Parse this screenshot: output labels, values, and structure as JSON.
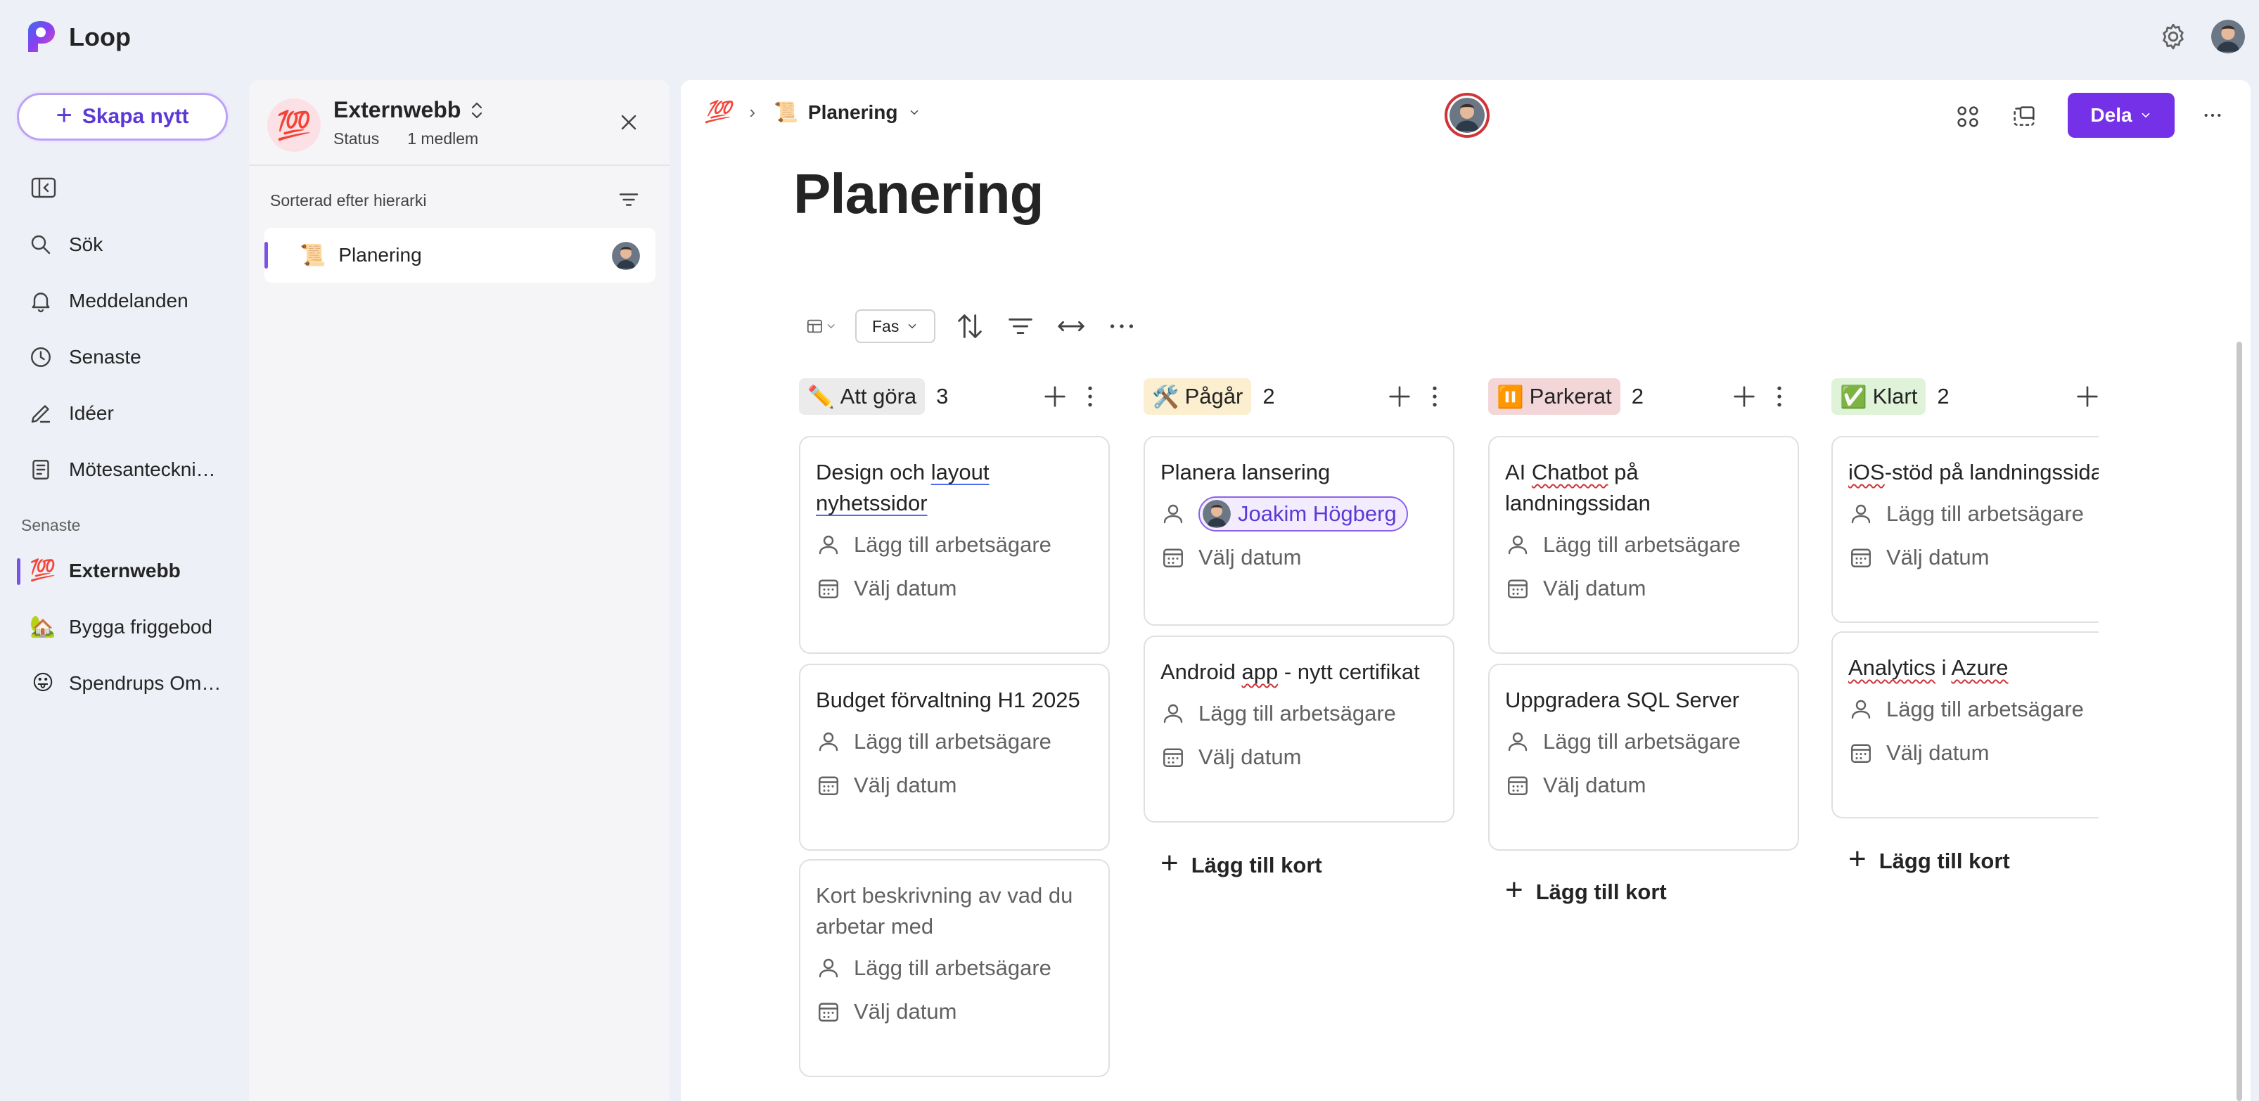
{
  "app": {
    "name": "Loop"
  },
  "nav": {
    "create_label": "Skapa nytt",
    "items": [
      {
        "label": "Sök",
        "icon": "search-icon"
      },
      {
        "label": "Meddelanden",
        "icon": "bell-icon"
      },
      {
        "label": "Senaste",
        "icon": "clock-icon"
      },
      {
        "label": "Idéer",
        "icon": "pencil-icon"
      },
      {
        "label": "Mötesanteckningar",
        "icon": "notes-icon"
      }
    ],
    "recent_label": "Senaste",
    "workspaces": [
      {
        "label": "Externwebb",
        "emoji": "💯",
        "active": true
      },
      {
        "label": "Bygga friggebod",
        "emoji": "🏡",
        "active": false
      },
      {
        "label": "Spendrups Omvärldsbevakning",
        "emoji": "😛",
        "active": false
      }
    ]
  },
  "workspace_panel": {
    "title": "Externwebb",
    "status": "Status",
    "members": "1 medlem",
    "sort_label": "Sorterad efter hierarki",
    "pages": [
      {
        "label": "Planering",
        "emoji": "📜"
      }
    ]
  },
  "main": {
    "breadcrumb": {
      "workspace_emoji": "💯",
      "page": "Planering",
      "page_emoji": "📜"
    },
    "share_label": "Dela",
    "title": "Planering",
    "toolbar": {
      "group_by": "Fas"
    },
    "columns": [
      {
        "label": "Att göra",
        "emoji": "✏️",
        "count": "3",
        "pill_color": "#ebebeb",
        "cards": [
          {
            "title_a": "Design och ",
            "title_b": "layout nyhetssidor",
            "owner": "Lägg till arbetsägare",
            "date": "Välj datum"
          },
          {
            "title": "Budget förvaltning H1 2025",
            "owner": "Lägg till arbetsägare",
            "date": "Välj datum"
          },
          {
            "title": "Kort beskrivning av vad du arbetar med",
            "owner": "Lägg till arbetsägare",
            "date": "Välj datum"
          }
        ]
      },
      {
        "label": "Pågår",
        "emoji": "🛠️",
        "count": "2",
        "pill_color": "#fbefcf",
        "cards": [
          {
            "title": "Planera lansering",
            "owner_name": "Joakim Högberg",
            "date": "Välj datum"
          },
          {
            "title_a": "Android ",
            "title_b": "app",
            "title_c": " - nytt certifikat",
            "owner": "Lägg till arbetsägare",
            "date": "Välj datum"
          }
        ],
        "add_label": "Lägg till kort"
      },
      {
        "label": "Parkerat",
        "emoji": "⏸️",
        "count": "2",
        "pill_color": "#f3d6d8",
        "cards": [
          {
            "title_a": "AI ",
            "title_b": "Chatbot",
            "title_c": " på landningssidan",
            "owner": "Lägg till arbetsägare",
            "date": "Välj datum"
          },
          {
            "title": "Uppgradera SQL Server",
            "owner": "Lägg till arbetsägare",
            "date": "Välj datum"
          }
        ],
        "add_label": "Lägg till kort"
      },
      {
        "label": "Klart",
        "emoji": "✅",
        "count": "2",
        "pill_color": "#dff3d8",
        "cards": [
          {
            "title_a": "iOS",
            "title_b": "-stöd på landningssidan",
            "owner": "Lägg till arbetsägare",
            "date": "Välj datum"
          },
          {
            "title_a": "Analytics",
            "title_b": " i ",
            "title_c": "Azure",
            "owner": "Lägg till arbetsägare",
            "date": "Välj datum"
          }
        ],
        "add_label": "Lägg till kort"
      }
    ]
  }
}
